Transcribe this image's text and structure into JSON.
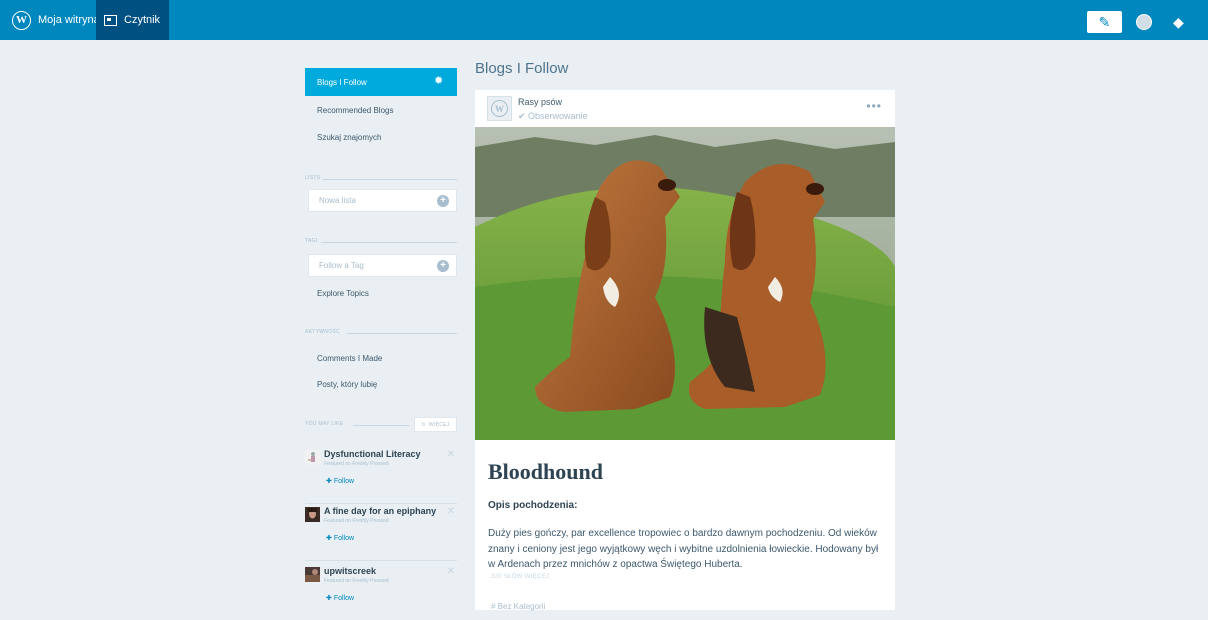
{
  "topbar": {
    "site_label": "Moja witryna",
    "reader_label": "Czytnik",
    "site_icon": "wordpress-icon",
    "reader_icon": "reader-icon",
    "write_icon": "pencil-icon",
    "avatar_icon": "avatar-icon",
    "notifications_icon": "notifications-icon",
    "color": "#0087be",
    "active_color": "#005082"
  },
  "sidebar": {
    "nav": [
      {
        "label": "Blogs I Follow",
        "active": true
      },
      {
        "label": "Recommended Blogs"
      },
      {
        "label": "Szukaj znajomych"
      }
    ],
    "lists": {
      "header": "LISTS",
      "placeholder": "Nowa lista"
    },
    "tags": {
      "header": "TAGI",
      "placeholder": "Follow a Tag",
      "explore_label": "Explore Topics"
    },
    "activity": {
      "header": "AKTYWNOŚĆ",
      "items": [
        "Comments I Made",
        "Posty, który lubię"
      ]
    },
    "you_may_like": {
      "header": "YOU MAY LIKE",
      "more_label": "WIĘCEJ",
      "items": [
        {
          "name": "Dysfunctional Literacy",
          "sub": "Featured on Freshly Pressed",
          "follow": "Follow"
        },
        {
          "name": "A fine day for an epiphany",
          "sub": "Featured on Freshly Pressed",
          "follow": "Follow"
        },
        {
          "name": "upwitscreek",
          "sub": "Featured on Freshly Pressed",
          "follow": "Follow"
        }
      ]
    },
    "active_color": "#00aadc"
  },
  "main": {
    "title": "Blogs I Follow",
    "post": {
      "site_name": "Rasy psów",
      "follow_status": "Obserwowanie",
      "title": "Bloodhound",
      "subtitle": "Opis pochodzenia:",
      "body": "Duży pies gończy, par excellence tropowiec o bardzo dawnym pochodzeniu. Od wieków znany i ceniony jest jego wyjątkowy węch i wybitne uzdolnienia łowieckie. Hodowany był w Ardenach przez mnichów z opactwa Świętego Huberta.",
      "word_count": "320 SŁÓW WIĘCEJ",
      "category": "Bez Kategorii"
    }
  }
}
